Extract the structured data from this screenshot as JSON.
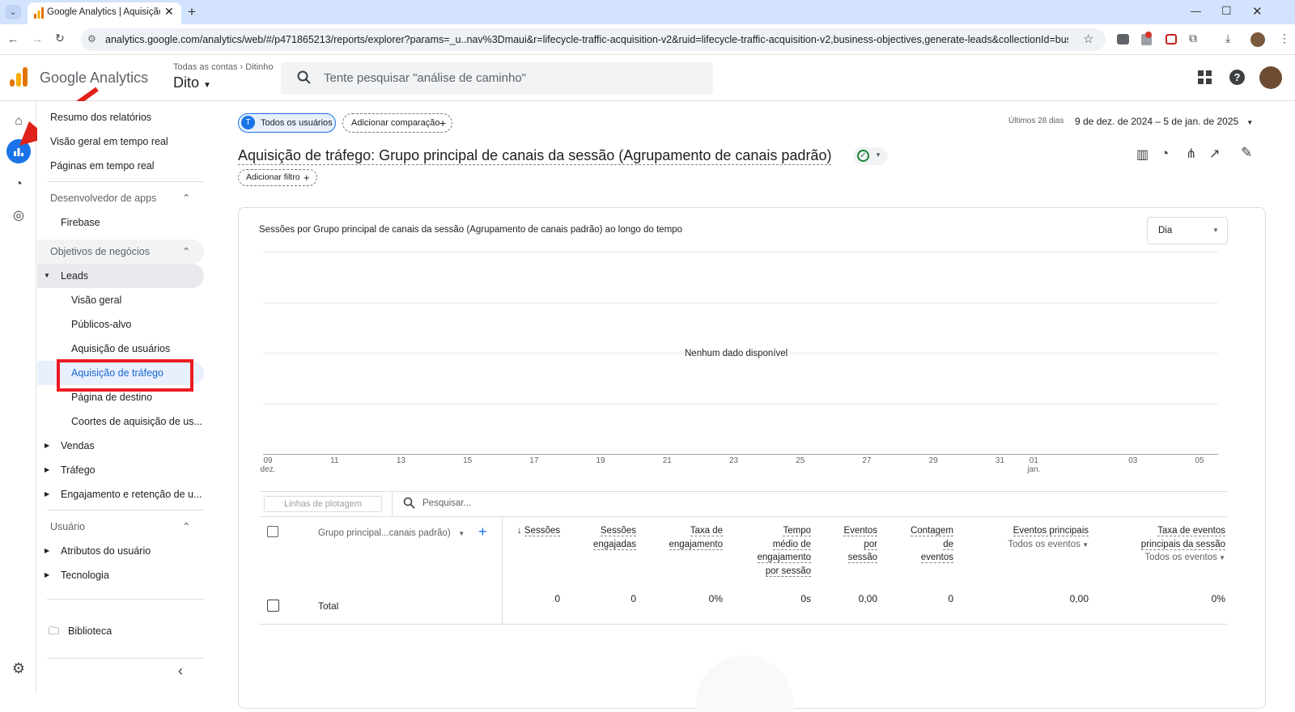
{
  "browser": {
    "tab_title": "Google Analytics | Aquisição de",
    "url": "analytics.google.com/analytics/web/#/p471865213/reports/explorer?params=_u..nav%3Dmaui&r=lifecycle-traffic-acquisition-v2&ruid=lifecycle-traffic-acquisition-v2,business-objectives,generate-leads&collectionId=business-objec..."
  },
  "header": {
    "product": "Google Analytics",
    "breadcrumb_1": "Todas as contas",
    "breadcrumb_2": "Ditinho",
    "property": "Dito",
    "search_placeholder": "Tente pesquisar \"análise de caminho\""
  },
  "nav": {
    "items": [
      {
        "label": "Resumo dos relatórios"
      },
      {
        "label": "Visão geral em tempo real"
      },
      {
        "label": "Páginas em tempo real"
      },
      {
        "label": "Desenvolvedor de apps"
      },
      {
        "label": "Firebase"
      },
      {
        "label": "Objetivos de negócios"
      },
      {
        "label": "Leads"
      },
      {
        "label": "Visão geral"
      },
      {
        "label": "Públicos-alvo"
      },
      {
        "label": "Aquisição de usuários"
      },
      {
        "label": "Aquisição de tráfego"
      },
      {
        "label": "Página de destino"
      },
      {
        "label": "Coortes de aquisição de us..."
      },
      {
        "label": "Vendas"
      },
      {
        "label": "Tráfego"
      },
      {
        "label": "Engajamento e retenção de u..."
      },
      {
        "label": "Usuário"
      },
      {
        "label": "Atributos do usuário"
      },
      {
        "label": "Tecnologia"
      },
      {
        "label": "Biblioteca"
      }
    ]
  },
  "main": {
    "segment_label": "Todos os usuários",
    "segment_initial": "T",
    "add_comparison": "Adicionar comparação",
    "date_prefix": "Últimos 28 dias",
    "date_range": "9 de dez. de 2024 – 5 de jan. de 2025",
    "report_title": "Aquisição de tráfego: Grupo principal de canais da sessão (Agrupamento de canais padrão)",
    "add_filter": "Adicionar filtro",
    "chart_title": "Sessões por Grupo principal de canais da sessão (Agrupamento de canais padrão) ao longo do tempo",
    "granularity": "Dia",
    "no_data": "Nenhum dado disponível",
    "plot_rows": "Linhas de plotagem",
    "table_search": "Pesquisar..."
  },
  "chart_data": {
    "type": "line",
    "title": "Sessões por Grupo principal de canais da sessão (Agrupamento de canais padrão) ao longo do tempo",
    "x_ticks": [
      "09",
      "11",
      "13",
      "15",
      "17",
      "19",
      "21",
      "23",
      "25",
      "27",
      "29",
      "31",
      "01",
      "03",
      "05"
    ],
    "x_tick_sub": {
      "09": "dez.",
      "01": "jan."
    },
    "series": [],
    "annotation": "Nenhum dado disponível"
  },
  "table": {
    "dimension_header": "Grupo principal...canais padrão)",
    "columns": [
      {
        "l1": "Sessões",
        "l2": "",
        "l3": "",
        "l4": "",
        "sorted": true
      },
      {
        "l1": "Sessões",
        "l2": "engajadas",
        "l3": "",
        "l4": ""
      },
      {
        "l1": "Taxa de",
        "l2": "engajamento",
        "l3": "",
        "l4": ""
      },
      {
        "l1": "Tempo",
        "l2": "médio de",
        "l3": "engajamento",
        "l4": "por sessão"
      },
      {
        "l1": "Eventos",
        "l2": "por",
        "l3": "sessão",
        "l4": ""
      },
      {
        "l1": "Contagem",
        "l2": "de",
        "l3": "eventos",
        "l4": ""
      },
      {
        "l1": "Eventos principais",
        "l2": "Todos os eventos",
        "l3": "",
        "l4": ""
      },
      {
        "l1": "Taxa de eventos",
        "l2": "principais da sessão",
        "l3": "Todos os eventos",
        "l4": ""
      }
    ],
    "total_label": "Total",
    "total_values": [
      "0",
      "0",
      "0%",
      "0s",
      "0,00",
      "0",
      "0,00",
      "0%"
    ]
  }
}
